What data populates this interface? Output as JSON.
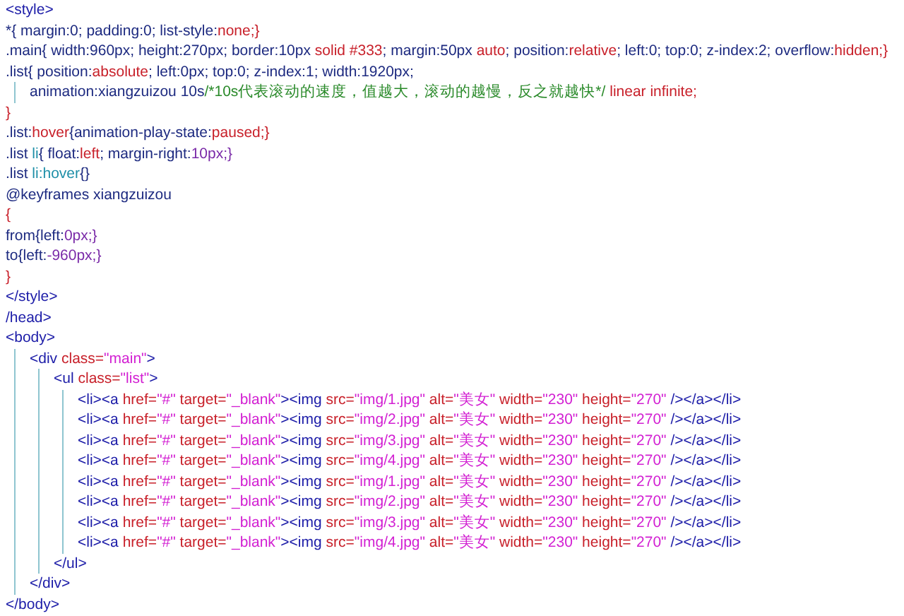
{
  "lines": [
    {
      "tokens": [
        {
          "kind": "tag",
          "text": "<style>"
        }
      ]
    },
    {
      "tokens": [
        {
          "kind": "plain",
          "text": "*{ margin:0; padding:0; list-style:"
        },
        {
          "kind": "keyword",
          "text": "none;}"
        }
      ]
    },
    {
      "tokens": [
        {
          "kind": "plain",
          "text": ".main{ width:960px; height:270px; border:10px "
        },
        {
          "kind": "keyword",
          "text": "solid #333"
        },
        {
          "kind": "plain",
          "text": "; margin:50px "
        },
        {
          "kind": "keyword",
          "text": "auto"
        },
        {
          "kind": "plain",
          "text": "; position:"
        },
        {
          "kind": "keyword",
          "text": "relative"
        },
        {
          "kind": "plain",
          "text": "; left:0; top:0; z-index:2; overflow:"
        },
        {
          "kind": "keyword",
          "text": "hidden;}"
        }
      ]
    },
    {
      "tokens": [
        {
          "kind": "plain",
          "text": ".list{ position:"
        },
        {
          "kind": "keyword",
          "text": "absolute"
        },
        {
          "kind": "plain",
          "text": "; left:0px; top:0; z-index:1; width:1920px;"
        }
      ],
      "children": [
        {
          "tokens": [
            {
              "kind": "plain",
              "text": "animation:xiangzuizou 10s"
            },
            {
              "kind": "comment",
              "text": "/*10s代表滚动的速度，值越大，滚动的越慢，反之就越快*/"
            },
            {
              "kind": "keyword",
              "text": " linear infinite;"
            }
          ]
        }
      ]
    },
    {
      "tokens": [
        {
          "kind": "keyword",
          "text": "}"
        }
      ]
    },
    {
      "tokens": [
        {
          "kind": "plain",
          "text": ".list:"
        },
        {
          "kind": "keyword",
          "text": "hover"
        },
        {
          "kind": "plain",
          "text": "{animation-play-state:"
        },
        {
          "kind": "keyword",
          "text": "paused;}"
        }
      ]
    },
    {
      "tokens": [
        {
          "kind": "plain",
          "text": ".list "
        },
        {
          "kind": "element",
          "text": "li"
        },
        {
          "kind": "plain",
          "text": "{ float:"
        },
        {
          "kind": "keyword",
          "text": "left"
        },
        {
          "kind": "plain",
          "text": "; margin-right:"
        },
        {
          "kind": "number",
          "text": "10px;}"
        }
      ]
    },
    {
      "tokens": [
        {
          "kind": "plain",
          "text": ".list "
        },
        {
          "kind": "element",
          "text": "li:hover"
        },
        {
          "kind": "plain",
          "text": "{}"
        }
      ]
    },
    {
      "tokens": [
        {
          "kind": "plain",
          "text": "@keyframes xiangzuizou"
        }
      ]
    },
    {
      "tokens": [
        {
          "kind": "keyword",
          "text": "{"
        }
      ]
    },
    {
      "tokens": [
        {
          "kind": "plain",
          "text": "from{left:"
        },
        {
          "kind": "number",
          "text": "0px;}"
        }
      ]
    },
    {
      "tokens": [
        {
          "kind": "plain",
          "text": "to{left:"
        },
        {
          "kind": "number",
          "text": "-960px;}"
        }
      ]
    },
    {
      "tokens": [
        {
          "kind": "keyword",
          "text": "}"
        }
      ]
    },
    {
      "tokens": [
        {
          "kind": "tag",
          "text": "</style>"
        }
      ]
    },
    {
      "tokens": [
        {
          "kind": "tag",
          "text": "/head>"
        }
      ]
    },
    {
      "tokens": [
        {
          "kind": "tag",
          "text": "<body>"
        }
      ],
      "children": [
        {
          "tokens": [
            {
              "kind": "tag",
              "text": "<div "
            },
            {
              "kind": "keyword",
              "text": "class="
            },
            {
              "kind": "string",
              "text": "\"main\""
            },
            {
              "kind": "tag",
              "text": ">"
            }
          ],
          "children": [
            {
              "tokens": [
                {
                  "kind": "tag",
                  "text": "<ul "
                },
                {
                  "kind": "keyword",
                  "text": "class="
                },
                {
                  "kind": "string",
                  "text": "\"list\""
                },
                {
                  "kind": "tag",
                  "text": ">"
                }
              ],
              "children": [
                {
                  "tokens": [
                    {
                      "kind": "tag",
                      "text": "<li><a "
                    },
                    {
                      "kind": "keyword",
                      "text": "href="
                    },
                    {
                      "kind": "string",
                      "text": "\"#\""
                    },
                    {
                      "kind": "keyword",
                      "text": " target="
                    },
                    {
                      "kind": "string",
                      "text": "\"_blank\""
                    },
                    {
                      "kind": "tag",
                      "text": "><img "
                    },
                    {
                      "kind": "keyword",
                      "text": "src="
                    },
                    {
                      "kind": "string",
                      "text": "\"img/1.jpg\""
                    },
                    {
                      "kind": "keyword",
                      "text": " alt="
                    },
                    {
                      "kind": "string",
                      "text": "\"美女\""
                    },
                    {
                      "kind": "keyword",
                      "text": " width="
                    },
                    {
                      "kind": "string",
                      "text": "\"230\""
                    },
                    {
                      "kind": "keyword",
                      "text": " height="
                    },
                    {
                      "kind": "string",
                      "text": "\"270\""
                    },
                    {
                      "kind": "tag",
                      "text": " /></a></li>"
                    }
                  ]
                },
                {
                  "tokens": [
                    {
                      "kind": "tag",
                      "text": "<li><a "
                    },
                    {
                      "kind": "keyword",
                      "text": "href="
                    },
                    {
                      "kind": "string",
                      "text": "\"#\""
                    },
                    {
                      "kind": "keyword",
                      "text": " target="
                    },
                    {
                      "kind": "string",
                      "text": "\"_blank\""
                    },
                    {
                      "kind": "tag",
                      "text": "><img "
                    },
                    {
                      "kind": "keyword",
                      "text": "src="
                    },
                    {
                      "kind": "string",
                      "text": "\"img/2.jpg\""
                    },
                    {
                      "kind": "keyword",
                      "text": " alt="
                    },
                    {
                      "kind": "string",
                      "text": "\"美女\""
                    },
                    {
                      "kind": "keyword",
                      "text": " width="
                    },
                    {
                      "kind": "string",
                      "text": "\"230\""
                    },
                    {
                      "kind": "keyword",
                      "text": " height="
                    },
                    {
                      "kind": "string",
                      "text": "\"270\""
                    },
                    {
                      "kind": "tag",
                      "text": " /></a></li>"
                    }
                  ]
                },
                {
                  "tokens": [
                    {
                      "kind": "tag",
                      "text": "<li><a "
                    },
                    {
                      "kind": "keyword",
                      "text": "href="
                    },
                    {
                      "kind": "string",
                      "text": "\"#\""
                    },
                    {
                      "kind": "keyword",
                      "text": " target="
                    },
                    {
                      "kind": "string",
                      "text": "\"_blank\""
                    },
                    {
                      "kind": "tag",
                      "text": "><img "
                    },
                    {
                      "kind": "keyword",
                      "text": "src="
                    },
                    {
                      "kind": "string",
                      "text": "\"img/3.jpg\""
                    },
                    {
                      "kind": "keyword",
                      "text": " alt="
                    },
                    {
                      "kind": "string",
                      "text": "\"美女\""
                    },
                    {
                      "kind": "keyword",
                      "text": " width="
                    },
                    {
                      "kind": "string",
                      "text": "\"230\""
                    },
                    {
                      "kind": "keyword",
                      "text": " height="
                    },
                    {
                      "kind": "string",
                      "text": "\"270\""
                    },
                    {
                      "kind": "tag",
                      "text": " /></a></li>"
                    }
                  ]
                },
                {
                  "tokens": [
                    {
                      "kind": "tag",
                      "text": "<li><a "
                    },
                    {
                      "kind": "keyword",
                      "text": "href="
                    },
                    {
                      "kind": "string",
                      "text": "\"#\""
                    },
                    {
                      "kind": "keyword",
                      "text": " target="
                    },
                    {
                      "kind": "string",
                      "text": "\"_blank\""
                    },
                    {
                      "kind": "tag",
                      "text": "><img "
                    },
                    {
                      "kind": "keyword",
                      "text": "src="
                    },
                    {
                      "kind": "string",
                      "text": "\"img/4.jpg\""
                    },
                    {
                      "kind": "keyword",
                      "text": " alt="
                    },
                    {
                      "kind": "string",
                      "text": "\"美女\""
                    },
                    {
                      "kind": "keyword",
                      "text": " width="
                    },
                    {
                      "kind": "string",
                      "text": "\"230\""
                    },
                    {
                      "kind": "keyword",
                      "text": " height="
                    },
                    {
                      "kind": "string",
                      "text": "\"270\""
                    },
                    {
                      "kind": "tag",
                      "text": " /></a></li>"
                    }
                  ]
                },
                {
                  "tokens": [
                    {
                      "kind": "tag",
                      "text": "<li><a "
                    },
                    {
                      "kind": "keyword",
                      "text": "href="
                    },
                    {
                      "kind": "string",
                      "text": "\"#\""
                    },
                    {
                      "kind": "keyword",
                      "text": " target="
                    },
                    {
                      "kind": "string",
                      "text": "\"_blank\""
                    },
                    {
                      "kind": "tag",
                      "text": "><img "
                    },
                    {
                      "kind": "keyword",
                      "text": "src="
                    },
                    {
                      "kind": "string",
                      "text": "\"img/1.jpg\""
                    },
                    {
                      "kind": "keyword",
                      "text": " alt="
                    },
                    {
                      "kind": "string",
                      "text": "\"美女\""
                    },
                    {
                      "kind": "keyword",
                      "text": " width="
                    },
                    {
                      "kind": "string",
                      "text": "\"230\""
                    },
                    {
                      "kind": "keyword",
                      "text": " height="
                    },
                    {
                      "kind": "string",
                      "text": "\"270\""
                    },
                    {
                      "kind": "tag",
                      "text": " /></a></li>"
                    }
                  ]
                },
                {
                  "tokens": [
                    {
                      "kind": "tag",
                      "text": "<li><a "
                    },
                    {
                      "kind": "keyword",
                      "text": "href="
                    },
                    {
                      "kind": "string",
                      "text": "\"#\""
                    },
                    {
                      "kind": "keyword",
                      "text": " target="
                    },
                    {
                      "kind": "string",
                      "text": "\"_blank\""
                    },
                    {
                      "kind": "tag",
                      "text": "><img "
                    },
                    {
                      "kind": "keyword",
                      "text": "src="
                    },
                    {
                      "kind": "string",
                      "text": "\"img/2.jpg\""
                    },
                    {
                      "kind": "keyword",
                      "text": " alt="
                    },
                    {
                      "kind": "string",
                      "text": "\"美女\""
                    },
                    {
                      "kind": "keyword",
                      "text": " width="
                    },
                    {
                      "kind": "string",
                      "text": "\"230\""
                    },
                    {
                      "kind": "keyword",
                      "text": " height="
                    },
                    {
                      "kind": "string",
                      "text": "\"270\""
                    },
                    {
                      "kind": "tag",
                      "text": " /></a></li>"
                    }
                  ]
                },
                {
                  "tokens": [
                    {
                      "kind": "tag",
                      "text": "<li><a "
                    },
                    {
                      "kind": "keyword",
                      "text": "href="
                    },
                    {
                      "kind": "string",
                      "text": "\"#\""
                    },
                    {
                      "kind": "keyword",
                      "text": " target="
                    },
                    {
                      "kind": "string",
                      "text": "\"_blank\""
                    },
                    {
                      "kind": "tag",
                      "text": "><img "
                    },
                    {
                      "kind": "keyword",
                      "text": "src="
                    },
                    {
                      "kind": "string",
                      "text": "\"img/3.jpg\""
                    },
                    {
                      "kind": "keyword",
                      "text": " alt="
                    },
                    {
                      "kind": "string",
                      "text": "\"美女\""
                    },
                    {
                      "kind": "keyword",
                      "text": " width="
                    },
                    {
                      "kind": "string",
                      "text": "\"230\""
                    },
                    {
                      "kind": "keyword",
                      "text": " height="
                    },
                    {
                      "kind": "string",
                      "text": "\"270\""
                    },
                    {
                      "kind": "tag",
                      "text": " /></a></li>"
                    }
                  ]
                },
                {
                  "tokens": [
                    {
                      "kind": "tag",
                      "text": "<li><a "
                    },
                    {
                      "kind": "keyword",
                      "text": "href="
                    },
                    {
                      "kind": "string",
                      "text": "\"#\""
                    },
                    {
                      "kind": "keyword",
                      "text": " target="
                    },
                    {
                      "kind": "string",
                      "text": "\"_blank\""
                    },
                    {
                      "kind": "tag",
                      "text": "><img "
                    },
                    {
                      "kind": "keyword",
                      "text": "src="
                    },
                    {
                      "kind": "string",
                      "text": "\"img/4.jpg\""
                    },
                    {
                      "kind": "keyword",
                      "text": " alt="
                    },
                    {
                      "kind": "string",
                      "text": "\"美女\""
                    },
                    {
                      "kind": "keyword",
                      "text": " width="
                    },
                    {
                      "kind": "string",
                      "text": "\"230\""
                    },
                    {
                      "kind": "keyword",
                      "text": " height="
                    },
                    {
                      "kind": "string",
                      "text": "\"270\""
                    },
                    {
                      "kind": "tag",
                      "text": " /></a></li>"
                    }
                  ]
                }
              ]
            },
            {
              "tokens": [
                {
                  "kind": "tag",
                  "text": "</ul>"
                }
              ]
            }
          ]
        },
        {
          "tokens": [
            {
              "kind": "tag",
              "text": "</div>"
            }
          ]
        }
      ]
    },
    {
      "tokens": [
        {
          "kind": "tag",
          "text": "</body>"
        }
      ]
    }
  ]
}
